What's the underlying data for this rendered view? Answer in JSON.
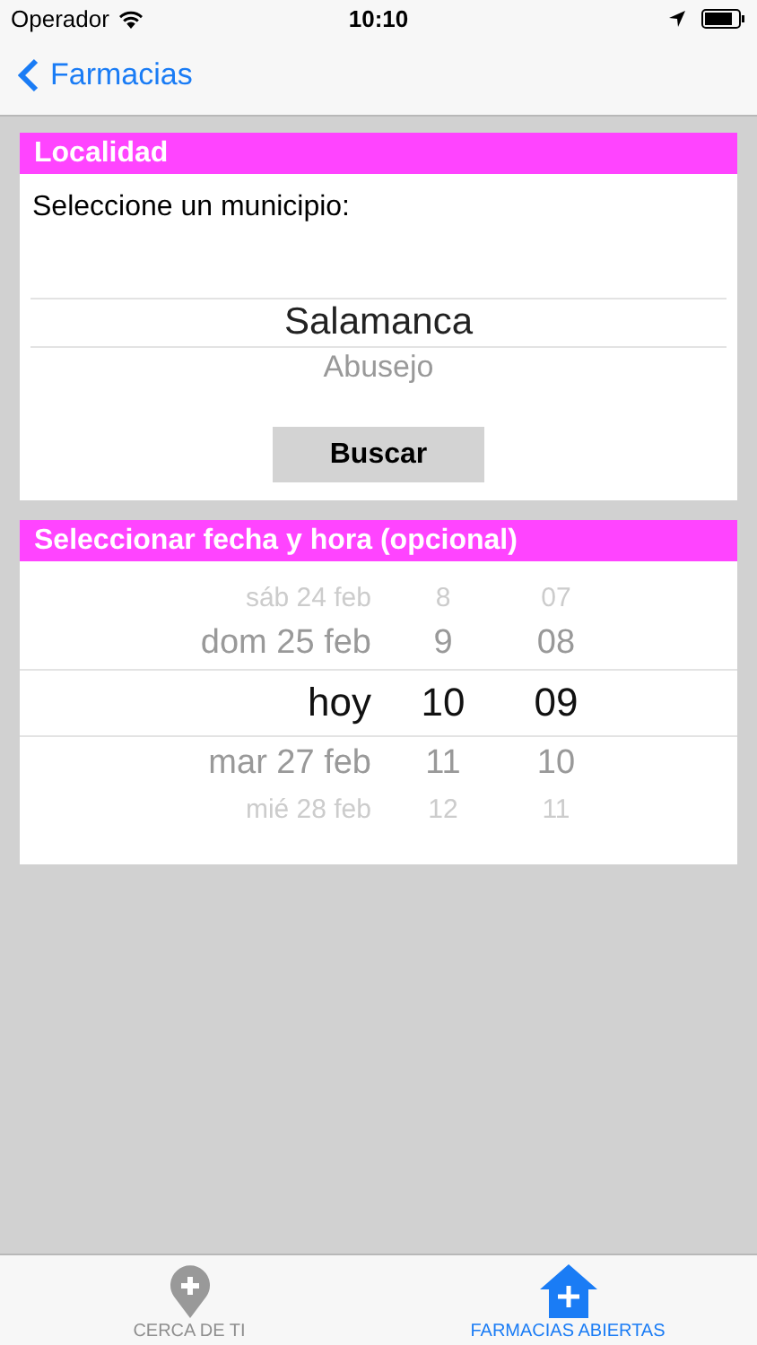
{
  "status_bar": {
    "carrier": "Operador",
    "time": "10:10"
  },
  "nav": {
    "back_label": "Farmacias"
  },
  "locality": {
    "title": "Localidad",
    "prompt": "Seleccione un municipio:",
    "options": [
      {
        "label": "Salamanca",
        "selected": true
      },
      {
        "label": "Abusejo",
        "selected": false
      }
    ],
    "button": "Buscar"
  },
  "datetime": {
    "title": "Seleccionar fecha y hora (opcional)",
    "rows": [
      {
        "day": "sáb 24 feb",
        "hour": "8",
        "minute": "07",
        "selected": false
      },
      {
        "day": "dom 25 feb",
        "hour": "9",
        "minute": "08",
        "selected": false
      },
      {
        "day": "hoy",
        "hour": "10",
        "minute": "09",
        "selected": true
      },
      {
        "day": "mar 27 feb",
        "hour": "11",
        "minute": "10",
        "selected": false
      },
      {
        "day": "mié 28 feb",
        "hour": "12",
        "minute": "11",
        "selected": false
      }
    ]
  },
  "tab_bar": [
    {
      "label": "CERCA DE TI",
      "kind": "pin",
      "selected": false
    },
    {
      "label": "FARMACIAS ABIERTAS",
      "kind": "house",
      "selected": true
    }
  ]
}
